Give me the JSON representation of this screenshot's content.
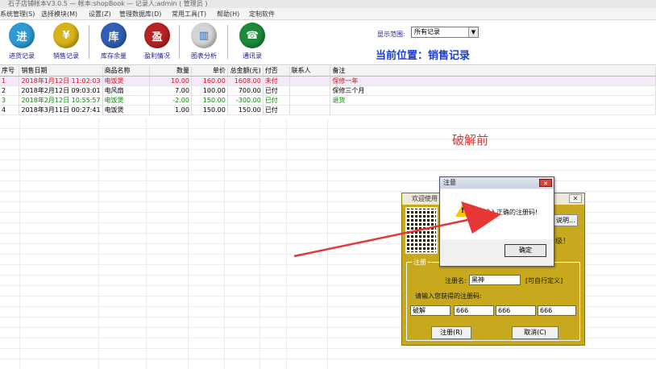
{
  "window": {
    "title": "石子店铺帐本V3.0.5  —  帐本:shopBook — 记录人:admin ( 管理员 )"
  },
  "menu": [
    "系统管理(S)",
    "选择模块(M)",
    "设置(Z)",
    "管理数据库(D)",
    "常用工具(T)",
    "帮助(H)",
    "定制软件"
  ],
  "toolbar": {
    "buttons": [
      {
        "label": "进货记录",
        "icon": "box-in-icon",
        "color": "#2e9bd6",
        "glyph": "进"
      },
      {
        "label": "销售记录",
        "icon": "gold-coin-icon",
        "color": "#d8b31a",
        "glyph": "¥"
      },
      {
        "label": "库存余量",
        "icon": "warehouse-icon",
        "color": "#2f5fb6",
        "glyph": "库"
      },
      {
        "label": "盈利情况",
        "icon": "profit-icon",
        "color": "#b82323",
        "glyph": "盈"
      },
      {
        "label": "图表分析",
        "icon": "bar-chart-icon",
        "color": "#d4d4d4",
        "glyph": "▥"
      },
      {
        "label": "通讯录",
        "icon": "phone-book-icon",
        "color": "#1c8a3a",
        "glyph": "☎"
      }
    ],
    "range_label": "显示范围:",
    "range_value": "所有记录",
    "location": "当前位置：销售记录"
  },
  "table": {
    "headers": [
      "序号",
      "销售日期",
      "商品名称",
      "数量",
      "单价",
      "总金额(元)",
      "付否",
      "联系人",
      "备注"
    ],
    "rows": [
      {
        "cells": [
          "1",
          "2018年1月12日 11:02:03",
          "电饭煲",
          "10.00",
          "160.00",
          "1608.00",
          "未付",
          "",
          "保修一年"
        ],
        "style": "red sel"
      },
      {
        "cells": [
          "2",
          "2018年2月12日 09:03:01",
          "电风扇",
          "7.00",
          "100.00",
          "700.00",
          "已付",
          "",
          "保修三个月"
        ],
        "style": ""
      },
      {
        "cells": [
          "3",
          "2018年2月12日 10:55:57",
          "电饭煲",
          "-2.00",
          "150.00",
          "-300.00",
          "已付",
          "",
          "退货"
        ],
        "style": "green"
      },
      {
        "cells": [
          "4",
          "2018年3月11日 00:27:41",
          "电饭煲",
          "1.00",
          "150.00",
          "150.00",
          "已付",
          "",
          ""
        ],
        "style": ""
      }
    ]
  },
  "annotation": "破解前",
  "register_dialog": {
    "title": "欢迎使用",
    "top_button": "说明...",
    "note": "级！",
    "group_label": "注册",
    "name_label": "注册名:",
    "name_value": "黑神",
    "name_hint": "[可自行定义]",
    "code_label": "请输入您获得的注册码:",
    "codes": [
      "破解",
      "666",
      "666",
      "666"
    ],
    "register_button": "注册(R)",
    "cancel_button": "取消(C)"
  },
  "alert": {
    "title": "注意",
    "message": "请输入正确的注册码!",
    "ok_button": "确定"
  },
  "colors": {
    "arrow": "#e83535",
    "location": "#1e3fd0",
    "dialog": "#c8a91e"
  }
}
